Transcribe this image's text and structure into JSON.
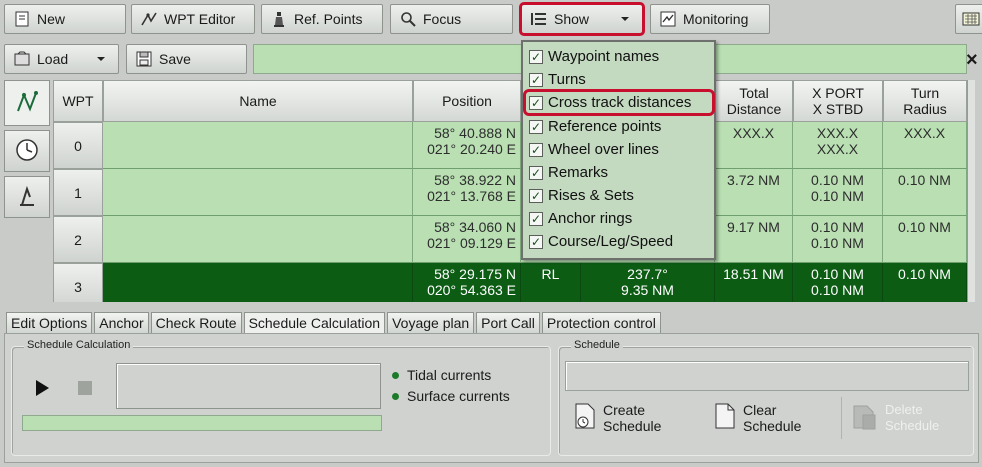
{
  "toolbar": {
    "new": "New",
    "wpt_editor": "WPT Editor",
    "ref_points": "Ref. Points",
    "focus": "Focus",
    "show": "Show",
    "monitoring": "Monitoring",
    "load": "Load",
    "save": "Save"
  },
  "grid": {
    "headers": {
      "wpt": "WPT",
      "name": "Name",
      "position": "Position",
      "total_line1": "Total",
      "total_line2": "Distance",
      "xport_line1": "X PORT",
      "xport_line2": "X STBD",
      "turn_line1": "Turn",
      "turn_line2": "Radius"
    },
    "rows": [
      {
        "wpt": "0",
        "lat": "58° 40.888 N",
        "lon": "021° 20.240 E",
        "total": "XXX.X",
        "x1": "XXX.X",
        "x2": "XXX.X",
        "turn": "XXX.X",
        "selected": false
      },
      {
        "wpt": "1",
        "lat": "58° 38.922 N",
        "lon": "021° 13.768 E",
        "total": "3.72 NM",
        "x1": "0.10 NM",
        "x2": "0.10 NM",
        "turn": "0.10 NM",
        "selected": false
      },
      {
        "wpt": "2",
        "lat": "58° 34.060 N",
        "lon": "021° 09.129 E",
        "total": "9.17 NM",
        "x1": "0.10 NM",
        "x2": "0.10 NM",
        "turn": "0.10 NM",
        "selected": false
      },
      {
        "wpt": "3",
        "lat": "58° 29.175 N",
        "lon": "020° 54.363 E",
        "leg": "RL",
        "course": "237.7°",
        "dist": "9.35 NM",
        "total": "18.51 NM",
        "x1": "0.10 NM",
        "x2": "0.10 NM",
        "turn": "0.10 NM",
        "selected": true
      }
    ]
  },
  "show_menu": {
    "items": [
      {
        "label": "Waypoint names",
        "checked": true
      },
      {
        "label": "Turns",
        "checked": true
      },
      {
        "label": "Cross track distances",
        "checked": true,
        "highlighted": true
      },
      {
        "label": "Reference points",
        "checked": true
      },
      {
        "label": "Wheel over lines",
        "checked": true
      },
      {
        "label": "Remarks",
        "checked": true
      },
      {
        "label": "Rises & Sets",
        "checked": true
      },
      {
        "label": "Anchor rings",
        "checked": true
      },
      {
        "label": "Course/Leg/Speed",
        "checked": true
      }
    ]
  },
  "tabs": [
    "Edit Options",
    "Anchor",
    "Check Route",
    "Schedule Calculation",
    "Voyage plan",
    "Port Call",
    "Protection control"
  ],
  "active_tab": "Schedule Calculation",
  "schedule_calc": {
    "legend": "Schedule Calculation",
    "tidal": "Tidal currents",
    "surface": "Surface currents"
  },
  "schedule": {
    "legend": "Schedule",
    "create_line1": "Create",
    "create_line2": "Schedule",
    "clear_line1": "Clear",
    "clear_line2": "Schedule",
    "delete_line1": "Delete",
    "delete_line2": "Schedule"
  },
  "colors": {
    "highlight_red": "#c8102e",
    "row_green": "#b9dfb3",
    "selected_row": "#0c5c14"
  }
}
